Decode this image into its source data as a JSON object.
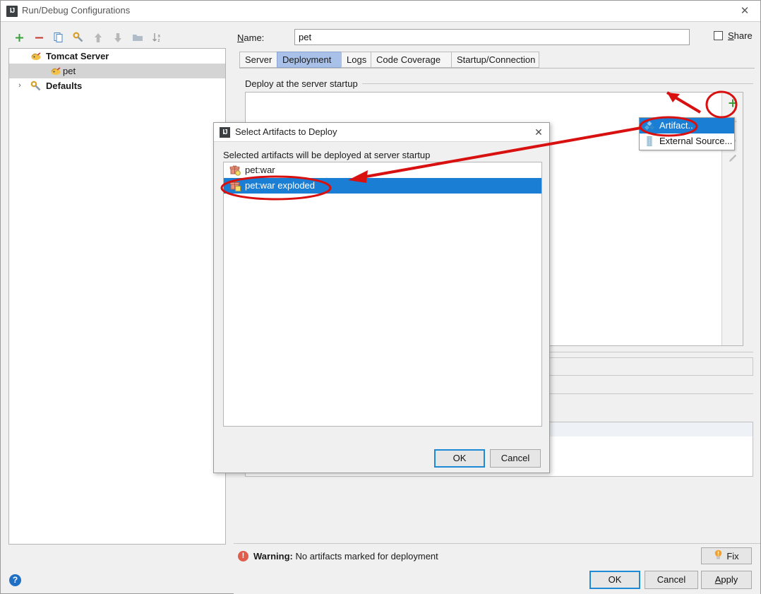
{
  "window": {
    "title": "Run/Debug Configurations",
    "app_icon": "intellij-idea-icon",
    "close_label": "✕"
  },
  "left_toolbar": {
    "buttons": [
      {
        "name": "add-configuration-button",
        "glyph": "+",
        "color": "#3a9e3a"
      },
      {
        "name": "remove-configuration-button",
        "glyph": "−",
        "color": "#c0392b"
      },
      {
        "name": "copy-configuration-button",
        "glyph": "copy-icon",
        "color": "#4a86c8"
      },
      {
        "name": "edit-templates-button",
        "glyph": "wrench-icon",
        "color": "#d8a028"
      },
      {
        "name": "move-up-button",
        "glyph": "⬆",
        "color": "#b3b3b3"
      },
      {
        "name": "move-down-button",
        "glyph": "⬇",
        "color": "#b3b3b3"
      },
      {
        "name": "folder-button",
        "glyph": "folder-icon",
        "color": "#b0bcc7"
      },
      {
        "name": "sort-alphabetically-button",
        "glyph": "sort-az-icon",
        "color": "#9a9a9a"
      }
    ]
  },
  "tree": {
    "nodes": [
      {
        "label": "Tomcat Server",
        "arrow": "ⱟ",
        "icon": "tomcat-icon",
        "indent": 30,
        "bold": true,
        "selected": false
      },
      {
        "label": "pet",
        "arrow": "",
        "icon": "tomcat-icon",
        "indent": 60,
        "bold": false,
        "selected": true
      },
      {
        "label": "Defaults",
        "arrow": "›",
        "icon": "wrench-icon",
        "indent": 30,
        "bold": true,
        "selected": false
      }
    ]
  },
  "form": {
    "name_label": "Name:",
    "name_label_mnemonic": "N",
    "name_value": "pet",
    "share_label": "Share",
    "share_mnemonic": "S",
    "share_checked": false
  },
  "tabs": {
    "items": [
      {
        "label": "Server",
        "active": false
      },
      {
        "label": "Deployment",
        "active": true
      },
      {
        "label": "Logs",
        "active": false
      },
      {
        "label": "Code Coverage",
        "active": false
      },
      {
        "label": "Startup/Connection",
        "active": false
      }
    ]
  },
  "deployment": {
    "group_title": "Deploy at the server startup",
    "side_buttons": [
      {
        "name": "add-artifact-button",
        "glyph": "+",
        "color": "#3a9e3a"
      },
      {
        "name": "remove-artifact-button",
        "glyph": "−",
        "color": "#cccccc"
      },
      {
        "name": "move-down-artifact-button",
        "glyph": "⬇",
        "color": "#b8b8b8"
      },
      {
        "name": "edit-artifact-button",
        "glyph": "pencil-icon",
        "color": "#b8b8b8"
      }
    ]
  },
  "popup_menu": {
    "items": [
      {
        "label": "Artifact..",
        "icon": "artifact-icon",
        "selected": true
      },
      {
        "label": "External Source...",
        "icon": "external-source-icon",
        "selected": false
      }
    ]
  },
  "modal": {
    "title": "Select Artifacts to Deploy",
    "icon": "intellij-idea-icon",
    "close_label": "✕",
    "subtitle": "Selected artifacts will be deployed at server startup",
    "list": [
      {
        "label": "pet:war",
        "icon": "artifact-war-icon",
        "selected": false
      },
      {
        "label": "pet:war exploded",
        "icon": "artifact-war-exploded-icon",
        "selected": true
      }
    ],
    "ok_label": "OK",
    "cancel_label": "Cancel"
  },
  "status": {
    "warning_prefix": "Warning:",
    "warning_message": "No artifacts marked for deployment",
    "warning_icon": "warning-icon",
    "fix_label": "Fix",
    "fix_icon": "lightbulb-icon"
  },
  "footer": {
    "ok_label": "OK",
    "cancel_label": "Cancel",
    "apply_label": "Apply",
    "apply_mnemonic": "A",
    "help_label": "?"
  },
  "colors": {
    "accent_blue": "#1a7fd4",
    "tab_active": "#a9c1e8",
    "annotation_red": "#d81010",
    "warning_red": "#e05c4b",
    "add_green": "#3a9e3a"
  }
}
